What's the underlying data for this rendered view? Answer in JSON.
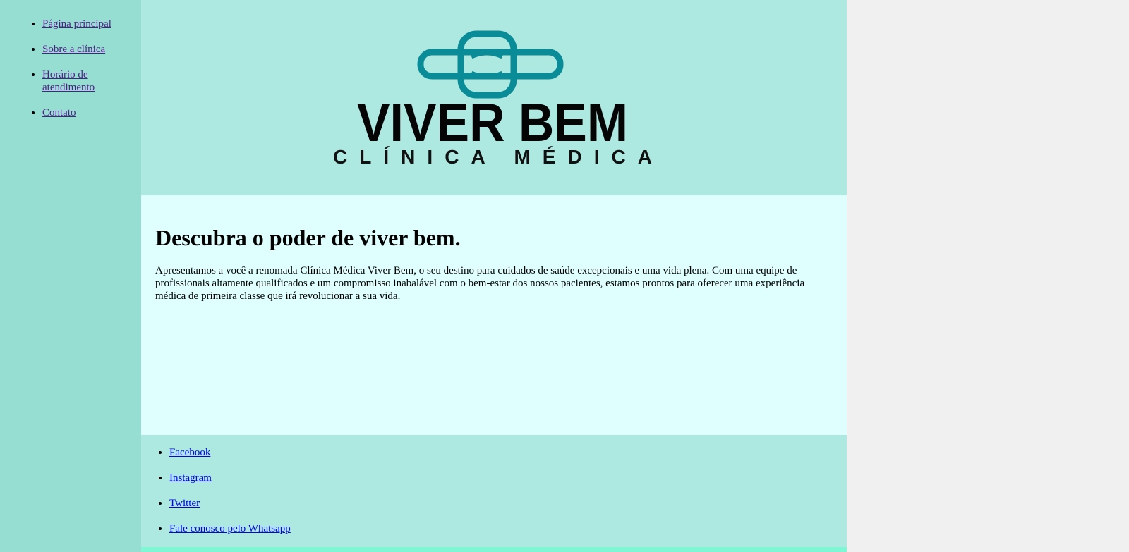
{
  "nav": {
    "items": [
      {
        "label": "Página principal"
      },
      {
        "label": "Sobre a clínica"
      },
      {
        "label": "Horário de atendimento"
      },
      {
        "label": "Contato"
      }
    ]
  },
  "logo": {
    "icon": "medical-cross-icon",
    "title": "VIVER BEM",
    "subtitle": "CLÍNICA MÉDICA",
    "icon_color": "#0a8c98"
  },
  "main": {
    "heading": "Descubra o poder de viver bem.",
    "paragraph": "Apresentamos a você a renomada Clínica Médica Viver Bem, o seu destino para cuidados de saúde excepcionais e uma vida plena. Com uma equipe de profissionais altamente qualificados e um compromisso inabalável com o bem-estar dos nossos pacientes, estamos prontos para oferecer uma experiência médica de primeira classe que irá revolucionar a sua vida."
  },
  "footer": {
    "links": [
      {
        "label": "Facebook"
      },
      {
        "label": "Instagram"
      },
      {
        "label": "Twitter"
      },
      {
        "label": "Fale conosco pelo Whatsapp"
      }
    ]
  },
  "colors": {
    "sidebar_bg": "#96ddd2",
    "header_bg": "#ade9e1",
    "main_bg": "#dfffff",
    "footer_bg": "#ade9e1",
    "accent_strip": "#7ff7d5"
  }
}
